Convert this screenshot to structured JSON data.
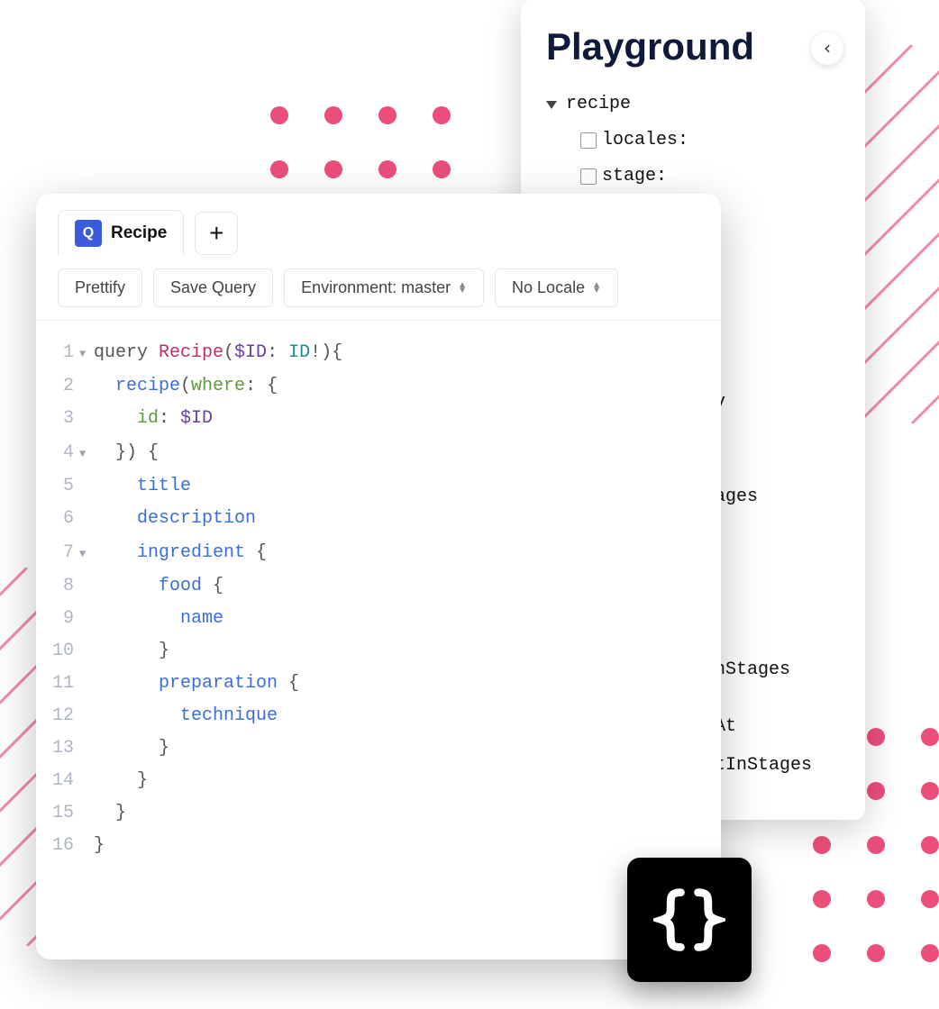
{
  "playground": {
    "title": "Playground",
    "tree_root": "recipe",
    "args": [
      "locales:",
      "stage:"
    ],
    "peek": [
      "v",
      "ages",
      "nStages",
      "At",
      "tInStages"
    ]
  },
  "editor": {
    "tab_badge": "Q",
    "tab_label": "Recipe",
    "toolbar": {
      "prettify": "Prettify",
      "save": "Save Query",
      "env": "Environment: master",
      "locale": "No Locale"
    },
    "code": [
      {
        "n": 1,
        "fold": true,
        "tokens": [
          [
            "k-punct",
            "query "
          ],
          [
            "k-def",
            "Recipe"
          ],
          [
            "k-punct",
            "("
          ],
          [
            "k-var",
            "$ID"
          ],
          [
            "k-punct",
            ": "
          ],
          [
            "k-type",
            "ID"
          ],
          [
            "k-punct",
            "!){"
          ]
        ]
      },
      {
        "n": 2,
        "tokens": [
          [
            "",
            "  "
          ],
          [
            "k-field",
            "recipe"
          ],
          [
            "k-punct",
            "("
          ],
          [
            "k-arg",
            "where"
          ],
          [
            "k-punct",
            ": {"
          ]
        ]
      },
      {
        "n": 3,
        "tokens": [
          [
            "",
            "    "
          ],
          [
            "k-arg",
            "id"
          ],
          [
            "k-punct",
            ": "
          ],
          [
            "k-var",
            "$ID"
          ]
        ]
      },
      {
        "n": 4,
        "fold": true,
        "tokens": [
          [
            "",
            "  "
          ],
          [
            "k-punct",
            "}) {"
          ]
        ]
      },
      {
        "n": 5,
        "tokens": [
          [
            "",
            "    "
          ],
          [
            "k-field",
            "title"
          ]
        ]
      },
      {
        "n": 6,
        "tokens": [
          [
            "",
            "    "
          ],
          [
            "k-field",
            "description"
          ]
        ]
      },
      {
        "n": 7,
        "fold": true,
        "tokens": [
          [
            "",
            "    "
          ],
          [
            "k-field",
            "ingredient"
          ],
          [
            "k-punct",
            " {"
          ]
        ]
      },
      {
        "n": 8,
        "tokens": [
          [
            "",
            "      "
          ],
          [
            "k-field",
            "food"
          ],
          [
            "k-punct",
            " {"
          ]
        ]
      },
      {
        "n": 9,
        "tokens": [
          [
            "",
            "        "
          ],
          [
            "k-field",
            "name"
          ]
        ]
      },
      {
        "n": 10,
        "tokens": [
          [
            "",
            "      "
          ],
          [
            "k-punct",
            "}"
          ]
        ]
      },
      {
        "n": 11,
        "tokens": [
          [
            "",
            "      "
          ],
          [
            "k-field",
            "preparation"
          ],
          [
            "k-punct",
            " {"
          ]
        ]
      },
      {
        "n": 12,
        "tokens": [
          [
            "",
            "        "
          ],
          [
            "k-field",
            "technique"
          ]
        ]
      },
      {
        "n": 13,
        "tokens": [
          [
            "",
            "      "
          ],
          [
            "k-punct",
            "}"
          ]
        ]
      },
      {
        "n": 14,
        "tokens": [
          [
            "",
            "    "
          ],
          [
            "k-punct",
            "}"
          ]
        ]
      },
      {
        "n": 15,
        "tokens": [
          [
            "",
            "  "
          ],
          [
            "k-punct",
            "}"
          ]
        ]
      },
      {
        "n": 16,
        "tokens": [
          [
            "k-punct",
            "}"
          ]
        ]
      }
    ]
  }
}
